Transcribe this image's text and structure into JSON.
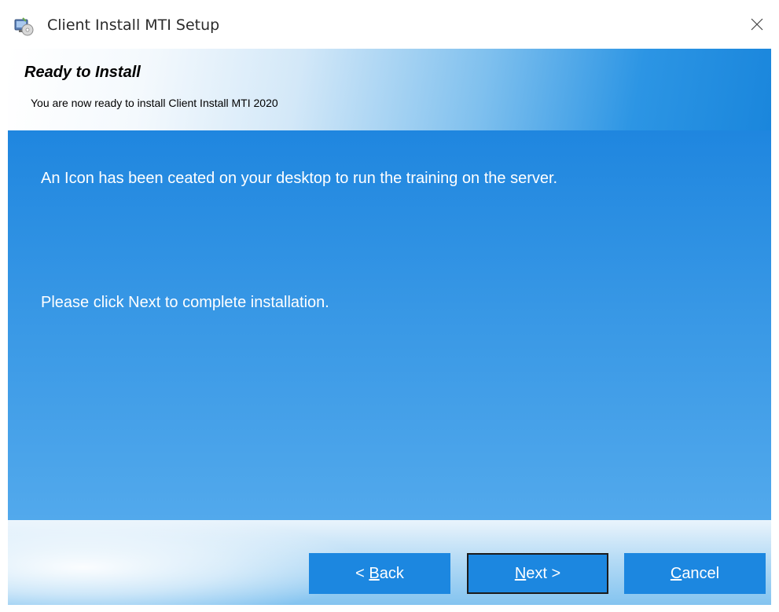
{
  "window": {
    "title": "Client Install MTI Setup"
  },
  "header": {
    "title": "Ready to Install",
    "subtitle": "You are now ready to install Client Install MTI 2020"
  },
  "content": {
    "message_1": "An Icon has been ceated on your desktop to run the training on the server.",
    "message_2": "Please click Next to  complete  installation."
  },
  "buttons": {
    "back": {
      "prefix": "< ",
      "mnemonic": "B",
      "rest": "ack"
    },
    "next": {
      "mnemonic": "N",
      "rest": "ext >"
    },
    "cancel": {
      "mnemonic": "C",
      "rest": "ancel"
    }
  },
  "colors": {
    "accent": "#1c87e0",
    "content_bg": "#3797e5"
  },
  "icons": {
    "app": "installer-icon",
    "close": "close-icon"
  }
}
